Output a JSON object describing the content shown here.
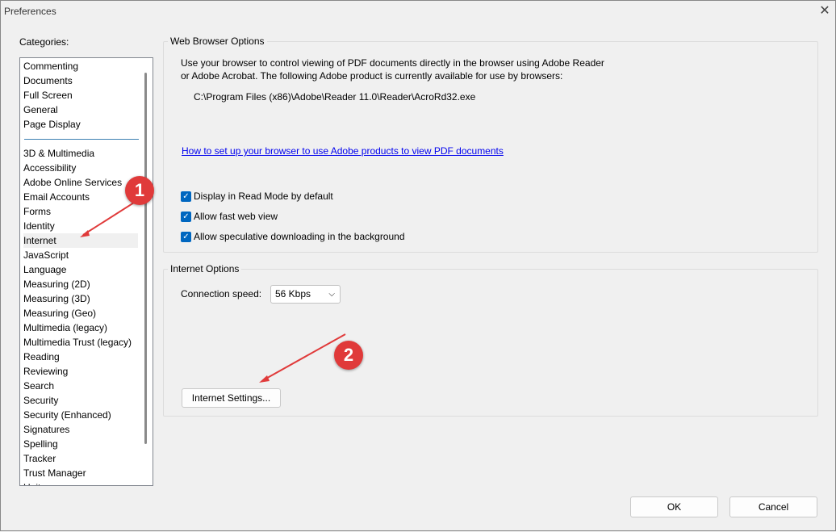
{
  "window": {
    "title": "Preferences",
    "close_icon": "close-icon"
  },
  "categories": {
    "label": "Categories:",
    "top": [
      "Commenting",
      "Documents",
      "Full Screen",
      "General",
      "Page Display"
    ],
    "bottom": [
      "3D & Multimedia",
      "Accessibility",
      "Adobe Online Services",
      "Email Accounts",
      "Forms",
      "Identity",
      "Internet",
      "JavaScript",
      "Language",
      "Measuring (2D)",
      "Measuring (3D)",
      "Measuring (Geo)",
      "Multimedia (legacy)",
      "Multimedia Trust (legacy)",
      "Reading",
      "Reviewing",
      "Search",
      "Security",
      "Security (Enhanced)",
      "Signatures",
      "Spelling",
      "Tracker",
      "Trust Manager",
      "Units"
    ],
    "selected": "Internet"
  },
  "web_browser": {
    "title": "Web Browser Options",
    "desc1": "Use your browser to control viewing of PDF documents directly in the browser using Adobe Reader",
    "desc2": "or Adobe Acrobat. The following Adobe product is currently available for use by browsers:",
    "path": "C:\\Program Files (x86)\\Adobe\\Reader 11.0\\Reader\\AcroRd32.exe",
    "link": "How to set up your browser to use Adobe products to view PDF documents",
    "checkboxes": [
      {
        "label": "Display in Read Mode by default",
        "checked": true
      },
      {
        "label": "Allow fast web view",
        "checked": true
      },
      {
        "label": "Allow speculative downloading in the background",
        "checked": true
      }
    ]
  },
  "internet": {
    "title": "Internet Options",
    "speed_label": "Connection speed:",
    "speed_value": "56 Kbps",
    "settings_button": "Internet Settings..."
  },
  "buttons": {
    "ok": "OK",
    "cancel": "Cancel"
  },
  "annotations": {
    "badge1": "1",
    "badge2": "2",
    "color": "#e03a3a"
  }
}
